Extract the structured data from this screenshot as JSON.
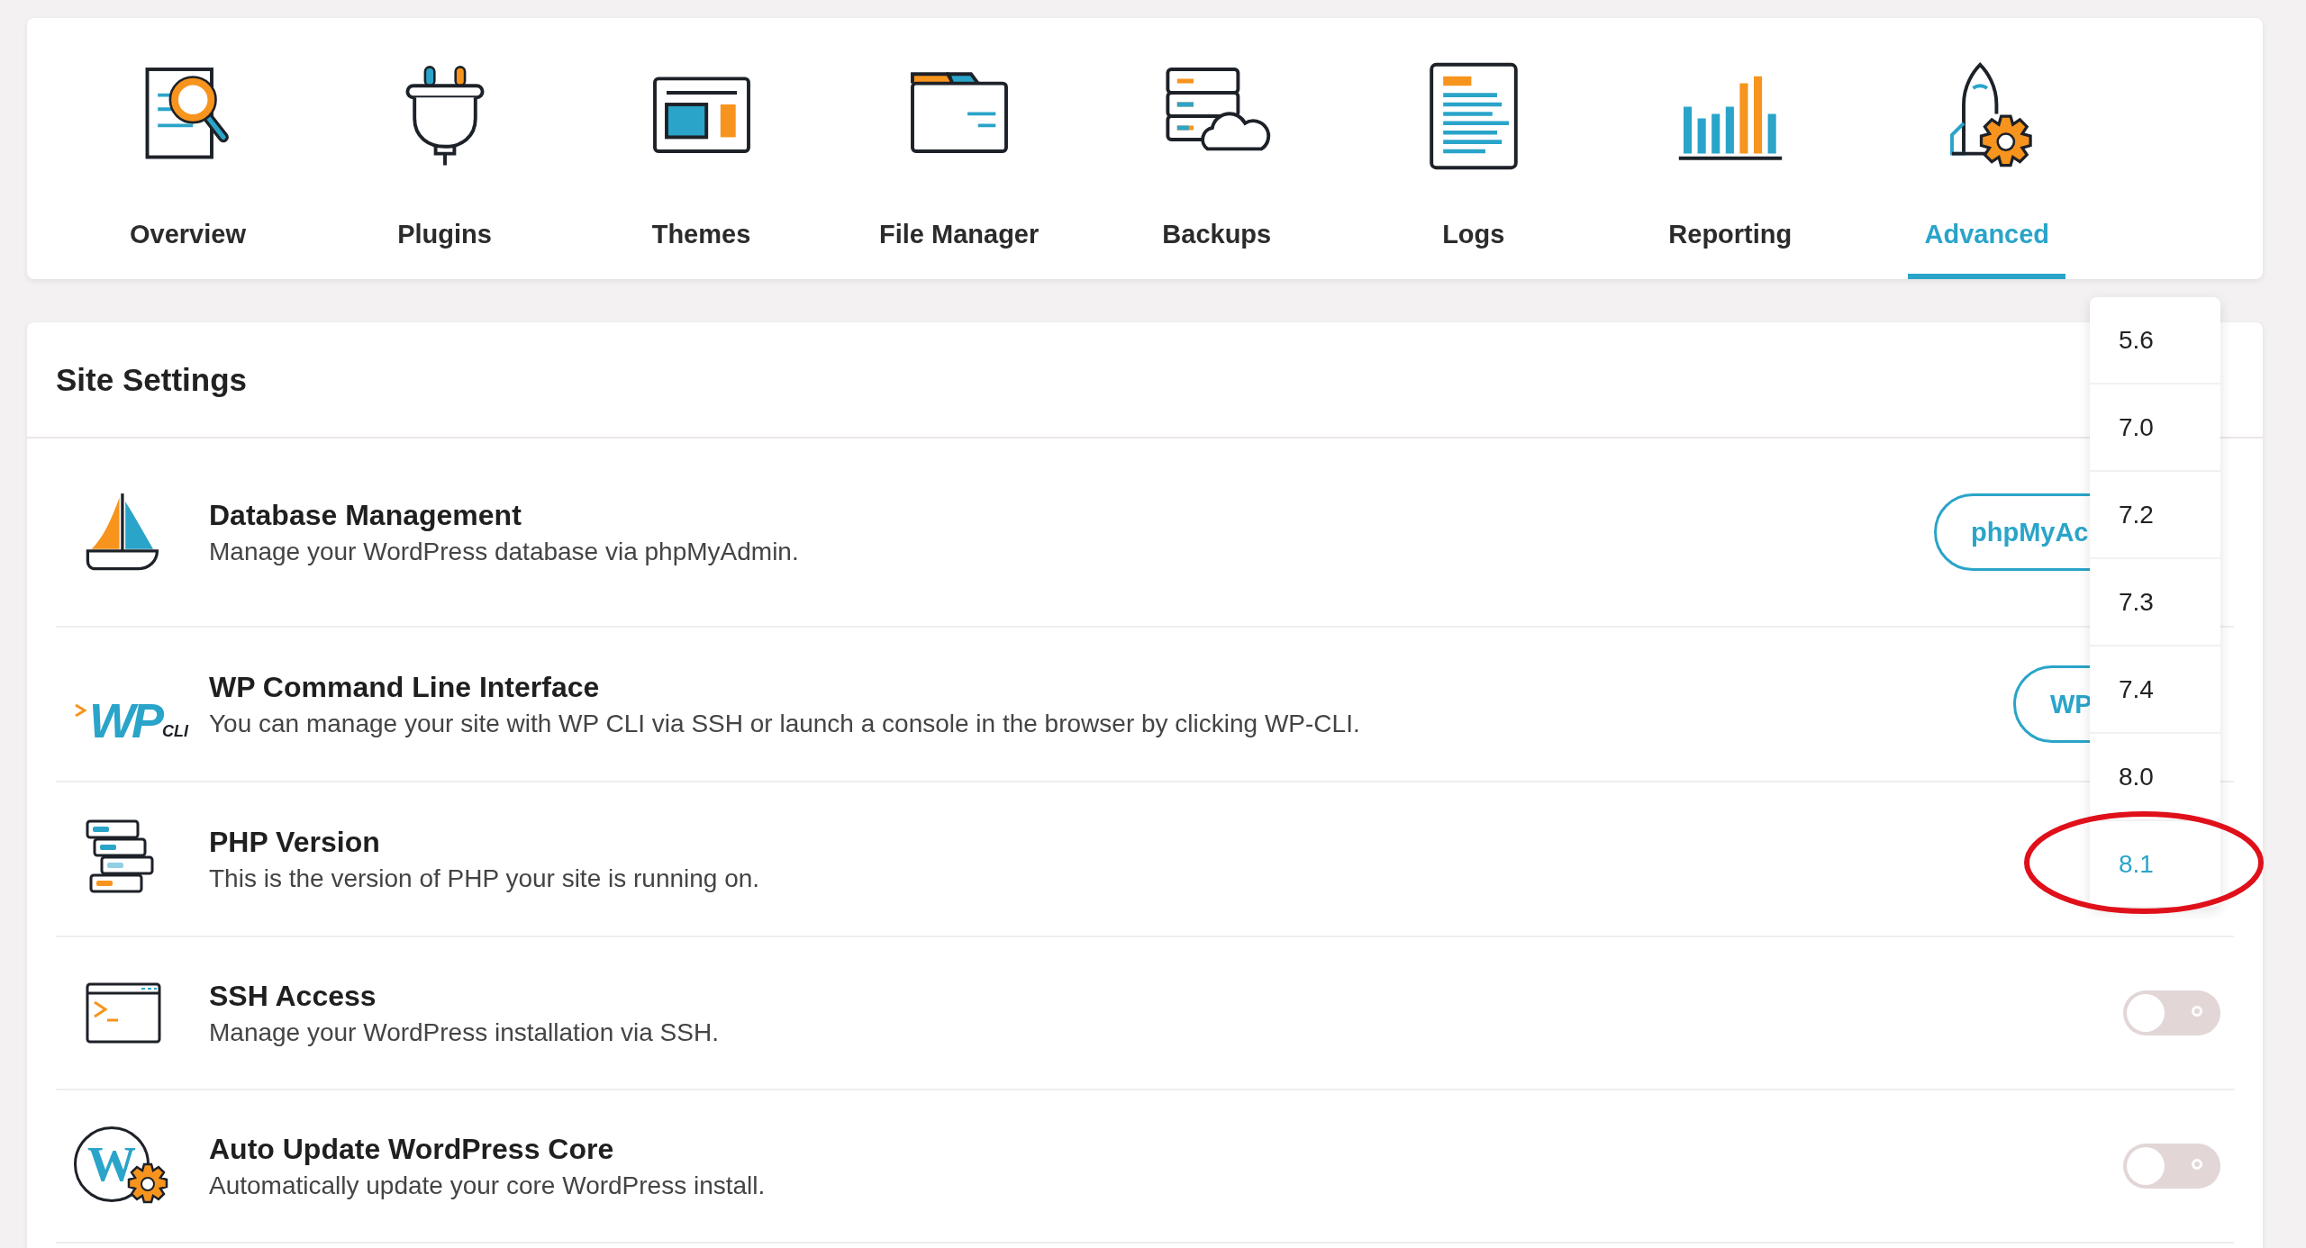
{
  "nav": {
    "tabs": [
      {
        "label": "Overview",
        "selected": false
      },
      {
        "label": "Plugins",
        "selected": false
      },
      {
        "label": "Themes",
        "selected": false
      },
      {
        "label": "File Manager",
        "selected": false
      },
      {
        "label": "Backups",
        "selected": false
      },
      {
        "label": "Logs",
        "selected": false
      },
      {
        "label": "Reporting",
        "selected": false
      },
      {
        "label": "Advanced",
        "selected": true
      }
    ]
  },
  "site_settings": {
    "title": "Site Settings",
    "rows": [
      {
        "kind": "button",
        "title": "Database Management",
        "description": "Manage your WordPress database via phpMyAdmin.",
        "button": "phpMyAc"
      },
      {
        "kind": "button",
        "title": "WP Command Line Interface",
        "description": "You can manage your site with WP CLI via SSH or launch a console in the browser by clicking WP-CLI.",
        "button": "WP",
        "logo_text": [
          "WP",
          "CLI"
        ]
      },
      {
        "kind": "select",
        "title": "PHP Version",
        "description": "This is the version of PHP your site is running on."
      },
      {
        "kind": "toggle",
        "title": "SSH Access",
        "description": "Manage your WordPress installation via SSH.",
        "on": false
      },
      {
        "kind": "toggle",
        "title": "Auto Update WordPress Core",
        "description": "Automatically update your core WordPress install.",
        "on": false,
        "logo_text": [
          "W"
        ]
      }
    ]
  },
  "php_version_menu": {
    "options": [
      {
        "label": "5.6",
        "selected": false
      },
      {
        "label": "7.0",
        "selected": false
      },
      {
        "label": "7.2",
        "selected": false
      },
      {
        "label": "7.3",
        "selected": false
      },
      {
        "label": "7.4",
        "selected": false
      },
      {
        "label": "8.0",
        "selected": false
      },
      {
        "label": "8.1",
        "selected": true
      }
    ]
  }
}
